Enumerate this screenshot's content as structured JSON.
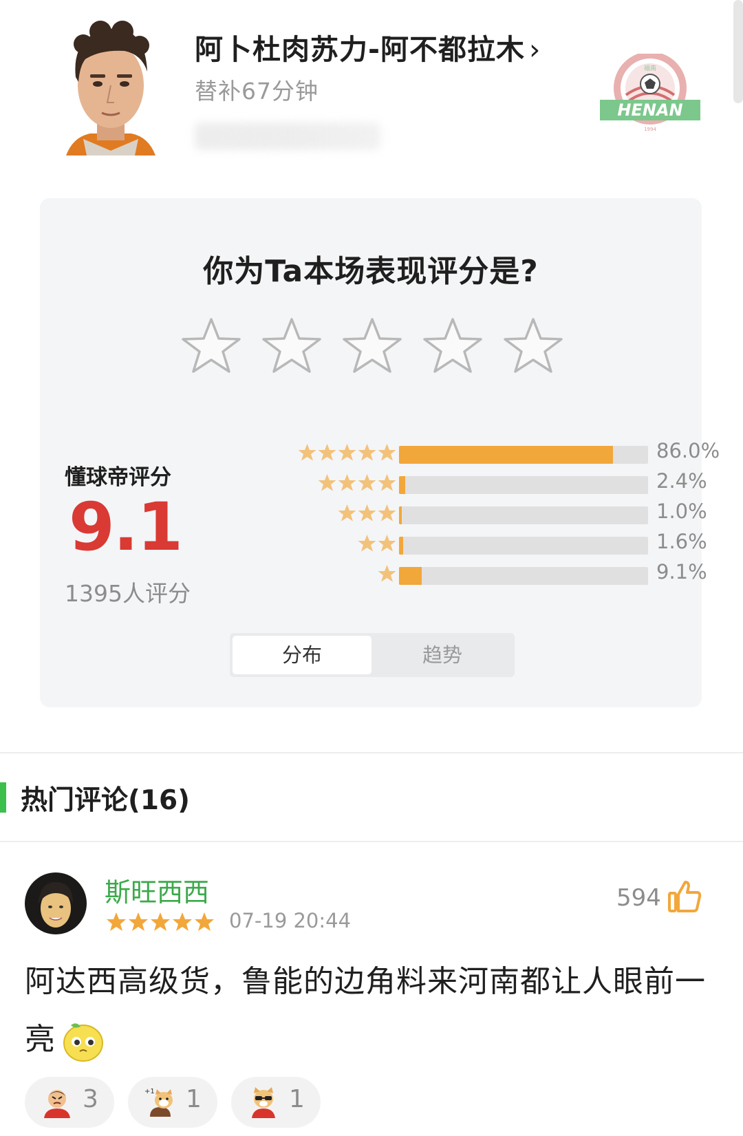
{
  "header": {
    "player_name": "阿卜杜肉苏力-阿不都拉木",
    "chevron": "›",
    "subtitle": "替补67分钟",
    "team_logo_text": "HENAN",
    "team_logo_top": "HENAN FOOTBALL CLUB",
    "team_logo_cn": "福南",
    "team_logo_year": "1994"
  },
  "rating": {
    "question": "你为Ta本场表现评分是?",
    "label": "懂球帝评分",
    "score": "9.1",
    "count": "1395人评分",
    "distribution": [
      {
        "stars": 5,
        "percent": 86.0,
        "label": "86.0%"
      },
      {
        "stars": 4,
        "percent": 2.4,
        "label": "2.4%"
      },
      {
        "stars": 3,
        "percent": 1.0,
        "label": "1.0%"
      },
      {
        "stars": 2,
        "percent": 1.6,
        "label": "1.6%"
      },
      {
        "stars": 1,
        "percent": 9.1,
        "label": "9.1%"
      }
    ],
    "tabs": {
      "active": "分布",
      "inactive": "趋势"
    }
  },
  "comments": {
    "title": "热门评论(16)",
    "item": {
      "username": "斯旺西西",
      "stars": 5,
      "time": "07-19 20:44",
      "likes": "594",
      "text": "阿达西高级货，鲁能的边角料来河南都让人眼前一亮",
      "reactions": [
        {
          "icon": "angry-face-icon",
          "count": "3"
        },
        {
          "icon": "dog-plus-one-icon",
          "count": "1"
        },
        {
          "icon": "dog-sunglasses-icon",
          "count": "1"
        }
      ]
    }
  },
  "colors": {
    "accent_orange": "#f2a73b",
    "score_red": "#d93a33",
    "username_green": "#3ba94a",
    "section_green": "#3cbf4c"
  }
}
